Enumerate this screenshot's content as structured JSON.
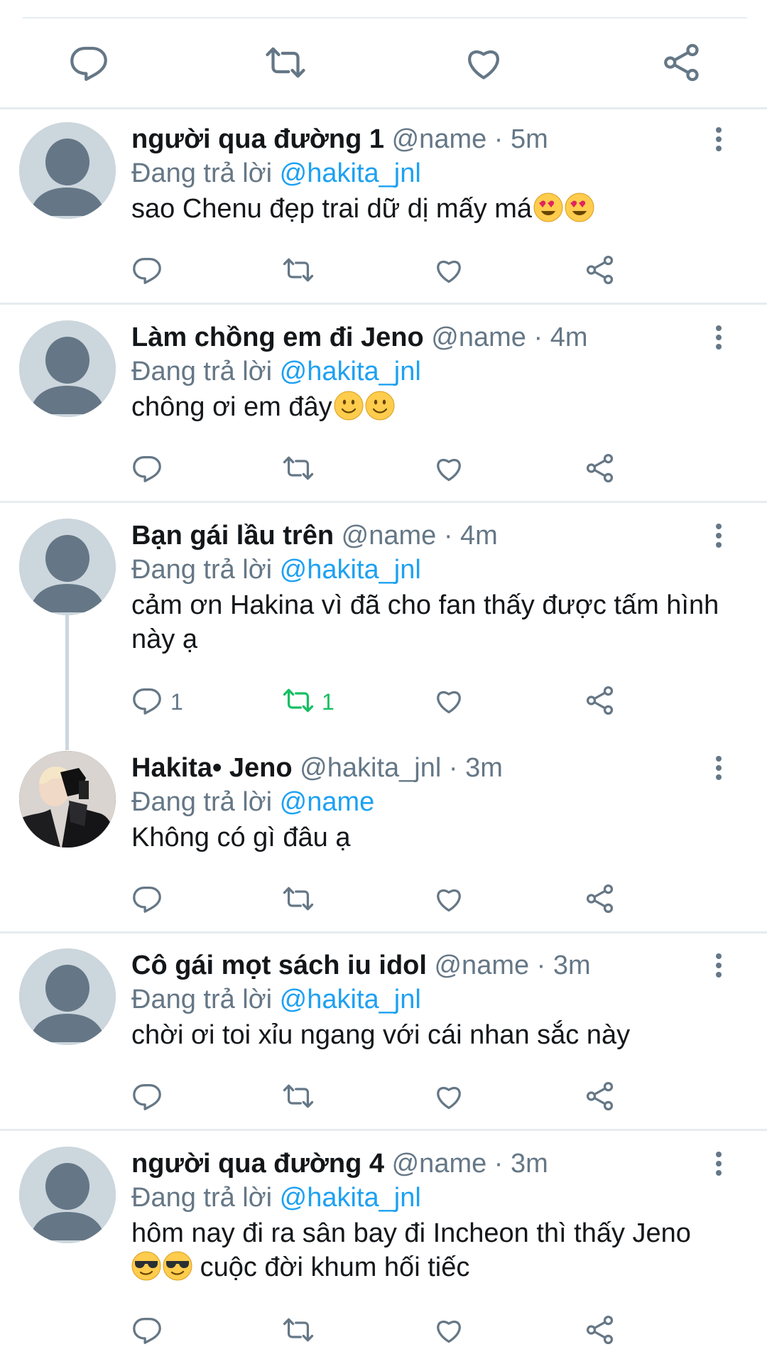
{
  "colors": {
    "accent": "#1da1f2",
    "muted": "#657786",
    "retweet_active": "#17bf63",
    "divider": "#e6ecf0",
    "avatar_bg": "#ccd6dd"
  },
  "icons": [
    "reply-icon",
    "retweet-icon",
    "like-icon",
    "share-icon",
    "more-icon"
  ],
  "replying_prefix": "Đang trả lời",
  "tweets": [
    {
      "name": "người qua đường 1",
      "meta": "@name · 5m",
      "reply_to": "@hakita_jnl",
      "text": "sao Chenu đẹp trai dữ dị mấy má",
      "emoji": [
        "heart-eyes",
        "heart-eyes"
      ]
    },
    {
      "name": "Làm chồng em đi Jeno",
      "meta": "@name · 4m",
      "reply_to": "@hakita_jnl",
      "text": "chông ơi em đây",
      "emoji": [
        "smile",
        "smile"
      ]
    },
    {
      "name": "Bạn gái lầu trên",
      "meta": "@name · 4m",
      "reply_to": "@hakita_jnl",
      "text": "cảm ơn Hakina vì đã cho fan thấy được tấm hình này ạ",
      "reply_count": "1",
      "retweet_count": "1"
    },
    {
      "name": "Hakita• Jeno",
      "meta": "@hakita_jnl · 3m",
      "reply_to": "@name",
      "text": "Không có gì đâu ạ"
    },
    {
      "name": "Cô gái mọt sách iu idol",
      "meta": "@name · 3m",
      "reply_to": "@hakita_jnl",
      "text": "chời ơi toi xỉu ngang với cái nhan sắc này"
    },
    {
      "name": "người qua đường 4",
      "meta": "@name · 3m",
      "reply_to": "@hakita_jnl",
      "text_after_emoji": "cuộc đời khum hối tiếc",
      "text": "hôm nay đi ra sân bay đi Incheon thì thấy Jeno",
      "emoji": [
        "sunglasses",
        "sunglasses"
      ]
    }
  ]
}
